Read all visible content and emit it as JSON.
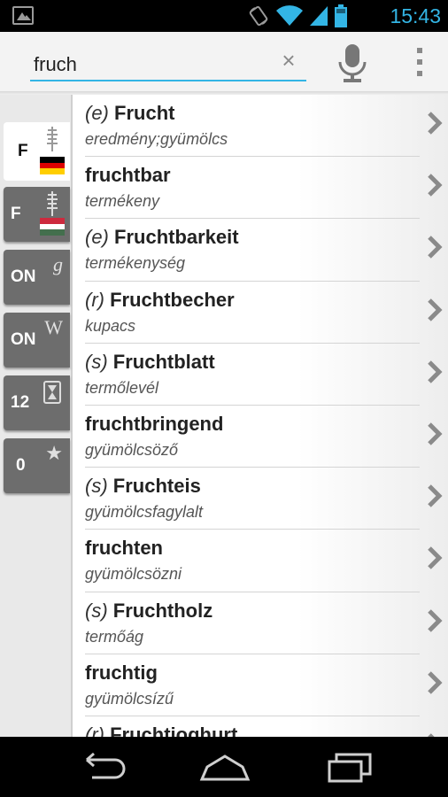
{
  "status_bar": {
    "time": "15:43",
    "icons": [
      "gallery-icon",
      "rotate-icon",
      "wifi-icon",
      "signal-icon",
      "battery-icon"
    ]
  },
  "search": {
    "value": "fruch",
    "clear_label": "×"
  },
  "sidebar": {
    "tabs": [
      {
        "label": "F",
        "icon": "book-icon",
        "flag": "german",
        "active": true
      },
      {
        "label": "F",
        "icon": "book-icon",
        "flag": "hungarian",
        "active": false
      },
      {
        "label": "ON",
        "icon": "google-icon",
        "glyph": "g",
        "active": false
      },
      {
        "label": "ON",
        "icon": "wikipedia-icon",
        "glyph": "W",
        "active": false
      },
      {
        "label": "12",
        "icon": "hourglass-icon",
        "active": false
      },
      {
        "label": "0",
        "icon": "star-icon",
        "glyph": "★",
        "active": false
      }
    ]
  },
  "results": [
    {
      "article": "(e)",
      "word": "Frucht",
      "translation": "eredmény;gyümölcs"
    },
    {
      "article": "",
      "word": "fruchtbar",
      "translation": "termékeny"
    },
    {
      "article": "(e)",
      "word": "Fruchtbarkeit",
      "translation": "termékenység"
    },
    {
      "article": "(r)",
      "word": "Fruchtbecher",
      "translation": "kupacs"
    },
    {
      "article": "(s)",
      "word": "Fruchtblatt",
      "translation": "termőlevél"
    },
    {
      "article": "",
      "word": "fruchtbringend",
      "translation": "gyümölcsöző"
    },
    {
      "article": "(s)",
      "word": "Fruchteis",
      "translation": "gyümölcsfagylalt"
    },
    {
      "article": "",
      "word": "fruchten",
      "translation": "gyümölcsözni"
    },
    {
      "article": "(s)",
      "word": "Fruchtholz",
      "translation": "termőág"
    },
    {
      "article": "",
      "word": "fruchtig",
      "translation": "gyümölcsízű"
    },
    {
      "article": "(r)",
      "word": "Fruchtjoghurt",
      "translation": ""
    }
  ],
  "colors": {
    "accent": "#33b5e5",
    "tab_inactive": "#6d6d6d",
    "flag_de": [
      "#000000",
      "#dd0000",
      "#ffce00"
    ],
    "flag_hu": [
      "#cd2a3e",
      "#ffffff",
      "#436f4d"
    ]
  }
}
